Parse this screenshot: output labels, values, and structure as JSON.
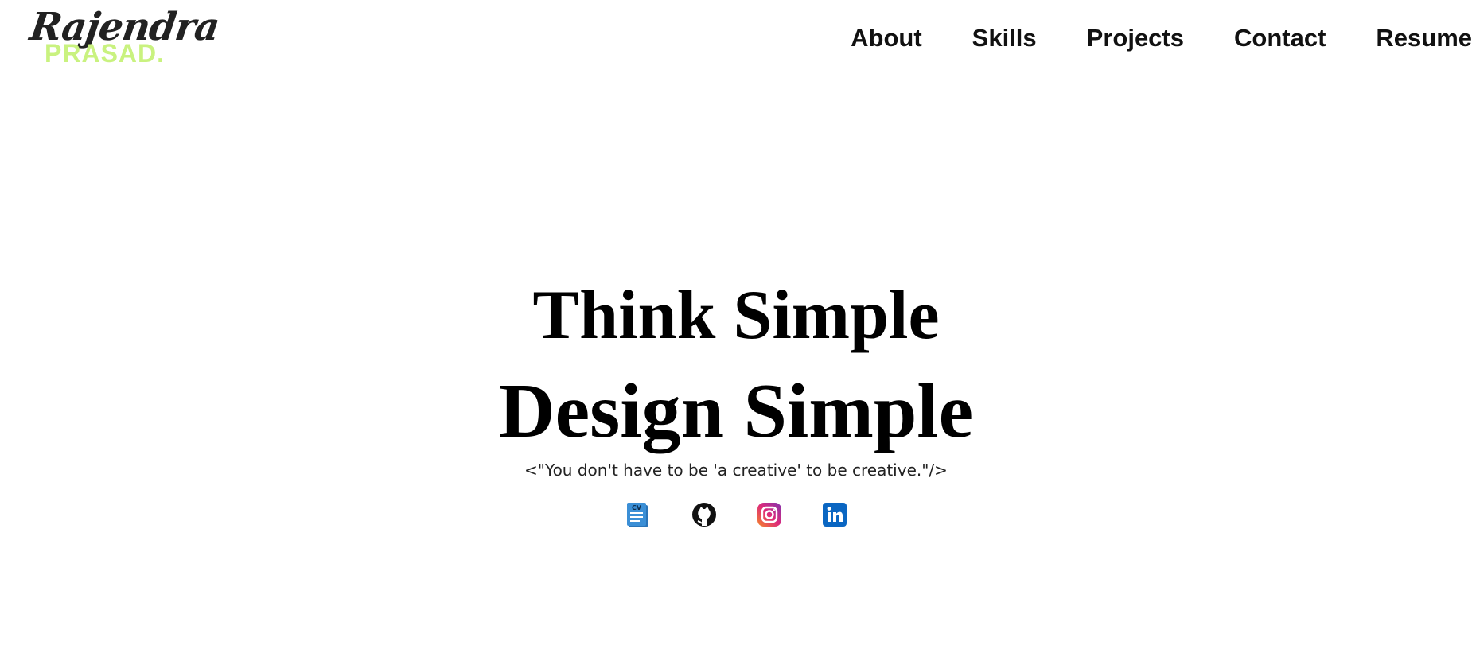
{
  "header": {
    "logo_script": "Rajendra",
    "logo_block": "PRASAD."
  },
  "nav": {
    "items": [
      {
        "label": "About"
      },
      {
        "label": "Skills"
      },
      {
        "label": "Projects"
      },
      {
        "label": "Contact"
      },
      {
        "label": "Resume"
      }
    ]
  },
  "hero": {
    "line1": "Think Simple",
    "line2": "Design Simple",
    "quote": "<\"You don't have to be 'a creative' to be creative.\"/>"
  },
  "socials": {
    "icons": [
      "cv-icon",
      "github-icon",
      "instagram-icon",
      "linkedin-icon"
    ],
    "cv_badge": "CV",
    "colors": {
      "cv": "#3b8fd6",
      "github": "#111111",
      "instagram_start": "#f58529",
      "instagram_end": "#8134af",
      "linkedin": "#0a66c2"
    }
  },
  "colors": {
    "accent": "#c9f27f",
    "text": "#111111",
    "background": "#ffffff"
  }
}
